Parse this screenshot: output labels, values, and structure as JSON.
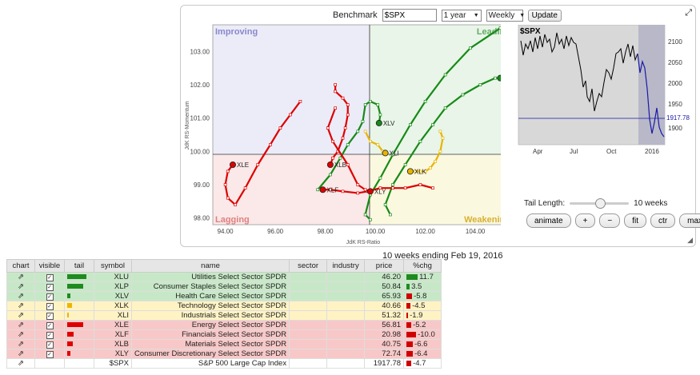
{
  "controls": {
    "benchmark_label": "Benchmark",
    "benchmark_value": "$SPX",
    "period": "1 year",
    "frequency": "Weekly",
    "update_label": "Update"
  },
  "rrg": {
    "quadrants": {
      "improving": "Improving",
      "leading": "Leading",
      "weakening": "Weakening",
      "lagging": "Lagging"
    },
    "xlabel": "JdK RS-Ratio",
    "ylabel": "JdK RS-Momentum",
    "xticks": [
      "94.00",
      "96.00",
      "98.00",
      "100.00",
      "102.00",
      "104.00"
    ],
    "yticks": [
      "103.00",
      "102.00",
      "101.00",
      "100.00",
      "99.00",
      "98.00"
    ]
  },
  "mini_chart": {
    "symbol": "$SPX",
    "yticks": [
      "2100",
      "2050",
      "2000",
      "1950",
      "1900"
    ],
    "xticks": [
      "Apr",
      "Jul",
      "Oct",
      "2016"
    ],
    "last_value": "1917.78"
  },
  "tail": {
    "label": "Tail Length:",
    "value": "10 weeks",
    "level": 10
  },
  "buttons": {
    "animate": "animate",
    "plus": "+",
    "minus": "−",
    "fit": "fit",
    "ctr": "ctr",
    "max": "max"
  },
  "caption": "10 weeks ending Feb 19, 2016",
  "table": {
    "headers": [
      "chart",
      "visible",
      "tail",
      "symbol",
      "name",
      "sector",
      "industry",
      "price",
      "%chg"
    ],
    "rows": [
      {
        "symbol": "XLU",
        "name": "Utilities Select Sector SPDR",
        "price": "46.20",
        "chg": "11.7",
        "q": "leading",
        "tail": "#1f8a1f",
        "tw": 24,
        "cw": 14,
        "cc": "#1f8a1f"
      },
      {
        "symbol": "XLP",
        "name": "Consumer Staples Select Sector SPDR",
        "price": "50.84",
        "chg": "3.5",
        "q": "leading",
        "tail": "#1f8a1f",
        "tw": 20,
        "cw": 4,
        "cc": "#1f8a1f"
      },
      {
        "symbol": "XLV",
        "name": "Health Care Select Sector SPDR",
        "price": "65.93",
        "chg": "-5.8",
        "q": "leading",
        "tail": "#1f8a1f",
        "tw": 4,
        "cw": 7,
        "cc": "#d00000"
      },
      {
        "symbol": "XLK",
        "name": "Technology Select Sector SPDR",
        "price": "40.66",
        "chg": "-4.5",
        "q": "weakening",
        "tail": "#f0b400",
        "tw": 6,
        "cw": 5,
        "cc": "#d00000"
      },
      {
        "symbol": "XLI",
        "name": "Industrials Select Sector SPDR",
        "price": "51.32",
        "chg": "-1.9",
        "q": "weakening",
        "tail": "#f0b400",
        "tw": 2,
        "cw": 2,
        "cc": "#d00000"
      },
      {
        "symbol": "XLE",
        "name": "Energy Select Sector SPDR",
        "price": "56.81",
        "chg": "-5.2",
        "q": "lagging",
        "tail": "#dd0000",
        "tw": 20,
        "cw": 6,
        "cc": "#d00000"
      },
      {
        "symbol": "XLF",
        "name": "Financials Select Sector SPDR",
        "price": "20.98",
        "chg": "-10.0",
        "q": "lagging",
        "tail": "#dd0000",
        "tw": 8,
        "cw": 12,
        "cc": "#d00000"
      },
      {
        "symbol": "XLB",
        "name": "Materials Select Sector SPDR",
        "price": "40.75",
        "chg": "-6.6",
        "q": "lagging",
        "tail": "#dd0000",
        "tw": 7,
        "cw": 8,
        "cc": "#d00000"
      },
      {
        "symbol": "XLY",
        "name": "Consumer Discretionary Select Sector SPDR",
        "price": "72.74",
        "chg": "-6.4",
        "q": "lagging",
        "tail": "#dd0000",
        "tw": 4,
        "cw": 8,
        "cc": "#d00000"
      },
      {
        "symbol": "$SPX",
        "name": "S&P 500 Large Cap Index",
        "price": "1917.78",
        "chg": "-4.7",
        "q": "none",
        "tail": "",
        "tw": 0,
        "cw": 6,
        "cc": "#d00000"
      }
    ]
  },
  "chart_data": {
    "type": "scatter",
    "title": "",
    "xlabel": "JdK RS-Ratio",
    "ylabel": "JdK RS-Momentum",
    "xlim": [
      93.5,
      105.5
    ],
    "ylim": [
      97.8,
      103.8
    ],
    "series": [
      {
        "name": "XLU",
        "color": "#178a17",
        "points": [
          [
            99.8,
            97.95
          ],
          [
            99.6,
            98.1
          ],
          [
            99.8,
            98.7
          ],
          [
            100.2,
            99.2
          ],
          [
            100.7,
            99.9
          ],
          [
            101.4,
            100.8
          ],
          [
            102.0,
            101.5
          ],
          [
            102.8,
            102.3
          ],
          [
            103.8,
            103.1
          ],
          [
            105.0,
            103.7
          ],
          [
            105.5,
            103.8
          ]
        ]
      },
      {
        "name": "XLP",
        "color": "#178a17",
        "points": [
          [
            100.6,
            98.1
          ],
          [
            100.4,
            98.4
          ],
          [
            100.7,
            99.0
          ],
          [
            101.2,
            99.6
          ],
          [
            101.8,
            100.3
          ],
          [
            102.3,
            100.8
          ],
          [
            102.8,
            101.3
          ],
          [
            103.5,
            101.7
          ],
          [
            104.2,
            102.0
          ],
          [
            104.8,
            102.2
          ],
          [
            105.0,
            102.2
          ]
        ]
      },
      {
        "name": "XLV",
        "color": "#178a17",
        "points": [
          [
            97.7,
            98.85
          ],
          [
            98.2,
            99.3
          ],
          [
            98.6,
            99.8
          ],
          [
            98.9,
            100.2
          ],
          [
            99.3,
            100.6
          ],
          [
            99.5,
            100.9
          ],
          [
            99.6,
            101.4
          ],
          [
            99.8,
            101.5
          ],
          [
            100.1,
            101.4
          ],
          [
            100.2,
            101.1
          ],
          [
            100.15,
            100.85
          ]
        ]
      },
      {
        "name": "XLK",
        "color": "#e8b400",
        "points": [
          [
            102.6,
            100.6
          ],
          [
            102.7,
            100.4
          ],
          [
            102.6,
            100.0
          ],
          [
            102.4,
            99.7
          ],
          [
            102.2,
            99.5
          ],
          [
            102.0,
            99.4
          ],
          [
            101.8,
            99.4
          ],
          [
            101.6,
            99.4
          ],
          [
            101.4,
            99.4
          ]
        ]
      },
      {
        "name": "XLI",
        "color": "#e8b400",
        "points": [
          [
            99.6,
            100.6
          ],
          [
            99.8,
            100.3
          ],
          [
            100.1,
            100.2
          ],
          [
            100.3,
            100.0
          ],
          [
            100.4,
            99.95
          ]
        ]
      },
      {
        "name": "XLE",
        "color": "#dd0000",
        "points": [
          [
            97.0,
            101.5
          ],
          [
            96.6,
            101.1
          ],
          [
            96.2,
            100.7
          ],
          [
            95.8,
            100.2
          ],
          [
            95.3,
            99.6
          ],
          [
            94.8,
            98.9
          ],
          [
            94.4,
            98.4
          ],
          [
            94.1,
            98.6
          ],
          [
            94.0,
            99.0
          ],
          [
            94.1,
            99.4
          ],
          [
            94.3,
            99.6
          ]
        ]
      },
      {
        "name": "XLF",
        "color": "#dd0000",
        "points": [
          [
            102.3,
            98.9
          ],
          [
            101.8,
            99.0
          ],
          [
            101.2,
            98.9
          ],
          [
            100.7,
            98.9
          ],
          [
            100.2,
            98.9
          ],
          [
            99.7,
            98.8
          ],
          [
            99.3,
            98.75
          ],
          [
            98.7,
            98.8
          ],
          [
            98.2,
            98.85
          ],
          [
            97.9,
            98.85
          ]
        ]
      },
      {
        "name": "XLB",
        "color": "#dd0000",
        "points": [
          [
            98.4,
            102.0
          ],
          [
            98.4,
            101.8
          ],
          [
            98.7,
            101.6
          ],
          [
            98.9,
            101.4
          ],
          [
            98.9,
            101.1
          ],
          [
            98.8,
            100.7
          ],
          [
            98.7,
            100.4
          ],
          [
            98.5,
            100.0
          ],
          [
            98.3,
            99.8
          ],
          [
            98.2,
            99.6
          ]
        ]
      },
      {
        "name": "XLY",
        "color": "#dd0000",
        "points": [
          [
            98.4,
            101.3
          ],
          [
            98.1,
            100.7
          ],
          [
            98.3,
            100.3
          ],
          [
            98.9,
            99.6
          ],
          [
            99.3,
            99.0
          ],
          [
            99.6,
            98.85
          ],
          [
            99.8,
            98.8
          ]
        ]
      }
    ]
  }
}
